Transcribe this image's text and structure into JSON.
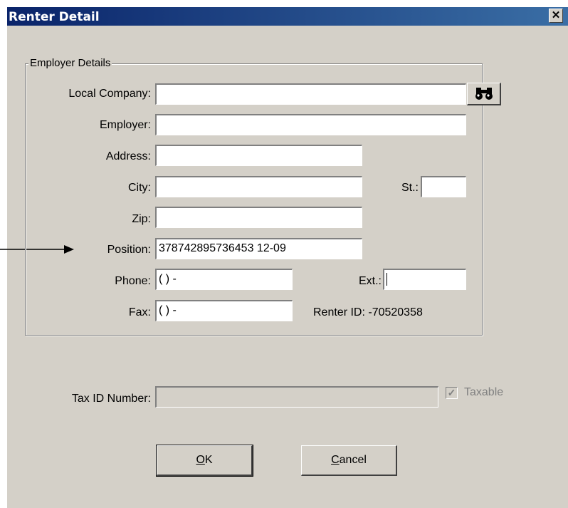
{
  "window": {
    "title": "Renter Detail",
    "close_glyph": "✕"
  },
  "group": {
    "legend": "Employer Details"
  },
  "fields": {
    "local_company": {
      "label": "Local Company:",
      "value": ""
    },
    "employer": {
      "label": "Employer:",
      "value": ""
    },
    "address": {
      "label": "Address:",
      "value": ""
    },
    "city": {
      "label": "City:",
      "value": ""
    },
    "state": {
      "label": "St.:",
      "value": ""
    },
    "zip": {
      "label": "Zip:",
      "value": ""
    },
    "position": {
      "label": "Position:",
      "value": "378742895736453  12-09"
    },
    "phone": {
      "label": "Phone:",
      "value": "(    )     -"
    },
    "ext": {
      "label": "Ext.:",
      "value": ""
    },
    "fax": {
      "label": "Fax:",
      "value": "(    )     -"
    }
  },
  "renter_id": "Renter ID: -70520358",
  "tax": {
    "label": "Tax ID Number:",
    "value": "",
    "checkbox_label": "Taxable",
    "checked": true
  },
  "buttons": {
    "ok_first": "O",
    "ok_rest": "K",
    "cancel_first": "C",
    "cancel_rest": "ancel"
  },
  "icons": {
    "lookup": "binoculars-icon",
    "arrow": "arrow-right-icon"
  }
}
